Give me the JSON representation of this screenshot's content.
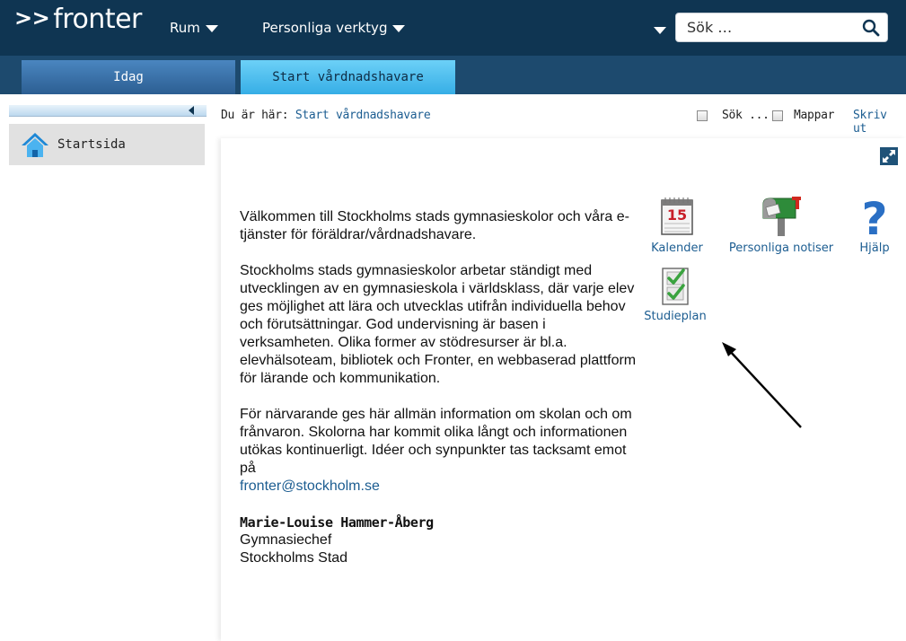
{
  "header": {
    "logo_arrows": ">>",
    "logo_text": "fronter",
    "nav": [
      {
        "label": "Rum"
      },
      {
        "label": "Personliga verktyg"
      }
    ],
    "search": {
      "placeholder": "Sök …"
    }
  },
  "tabs": [
    {
      "label": "Idag",
      "active": false
    },
    {
      "label": "Start vårdnadshavare",
      "active": true
    }
  ],
  "sidebar": {
    "items": [
      {
        "label": "Startsida",
        "icon": "home-icon"
      }
    ]
  },
  "breadcrumb": {
    "prefix": "Du är här:",
    "current": "Start vårdnadshavare"
  },
  "toolbar": {
    "search_label": "Sök ...",
    "folders_label": "Mappar",
    "print_label": "Skriv ut"
  },
  "welcome": {
    "p1": "Välkommen till Stockholms stads gymnasieskolor och våra e-tjänster för föräldrar/vårdnadshavare.",
    "p2": "Stockholms stads gymnasieskolor arbetar ständigt med utvecklingen av en gymnasieskola i världsklass, där varje elev ges möjlighet att lära och utvecklas utifrån individuella behov och förutsättningar. God undervisning är basen i verksamheten. Olika former av stödresurser är bl.a. elevhälsoteam, bibliotek och Fronter, en webbaserad plattform för lärande och kommunikation.",
    "p3": "För närvarande ges här allmän information om skolan och om frånvaron. Skolorna har kommit olika långt och informationen utökas kontinuerligt. Idéer och synpunkter tas tacksamt emot på",
    "email": "fronter@stockholm.se",
    "signature_name": "Marie-Louise Hammer-Åberg",
    "signature_title": "Gymnasiechef",
    "signature_org": "Stockholms Stad"
  },
  "apps": [
    {
      "label": "Kalender",
      "icon": "calendar-icon",
      "calendar_day": "15"
    },
    {
      "label": "Personliga notiser",
      "icon": "mailbox-icon"
    },
    {
      "label": "Hjälp",
      "icon": "help-icon",
      "glyph": "?"
    },
    {
      "label": "Studieplan",
      "icon": "checklist-icon"
    }
  ],
  "colors": {
    "header_bg": "#0f3552",
    "tabbar_bg": "#1d4a6e",
    "active_tab": "#47b8ec",
    "link": "#1c5d91"
  }
}
